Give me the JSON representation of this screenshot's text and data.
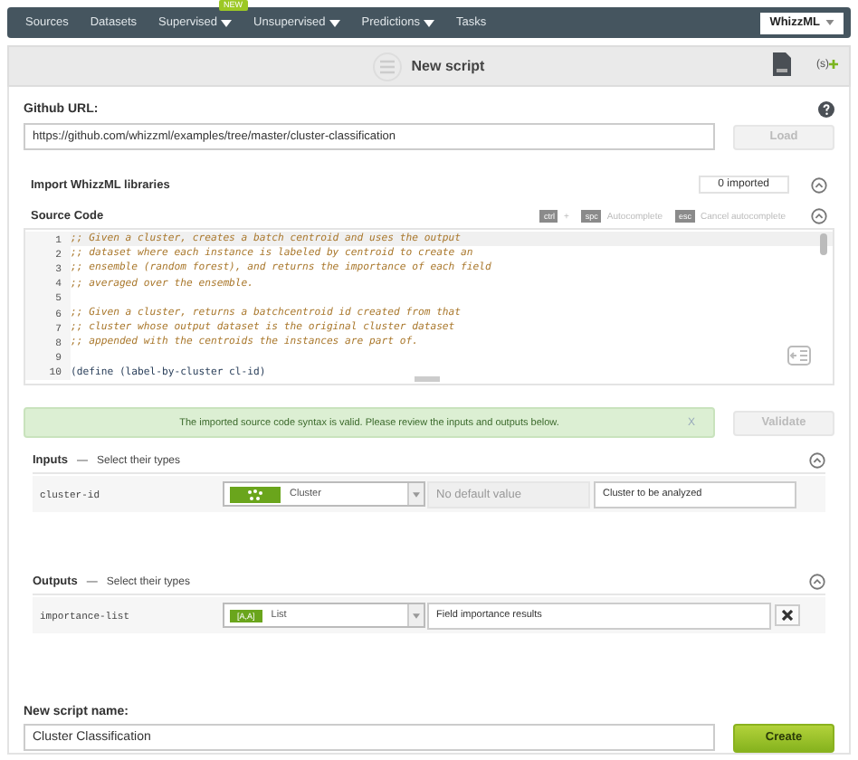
{
  "nav": {
    "items": [
      {
        "label": "Sources",
        "has_menu": false
      },
      {
        "label": "Datasets",
        "has_menu": false
      },
      {
        "label": "Supervised",
        "has_menu": true,
        "badge": "NEW"
      },
      {
        "label": "Unsupervised",
        "has_menu": true
      },
      {
        "label": "Predictions",
        "has_menu": true
      },
      {
        "label": "Tasks",
        "has_menu": false
      }
    ],
    "account": "WhizzML"
  },
  "header": {
    "title": "New script",
    "script_menu_label": "(s)"
  },
  "github": {
    "label": "Github URL:",
    "value": "https://github.com/whizzml/examples/tree/master/cluster-classification",
    "button": "Load",
    "button_disabled": true
  },
  "libraries": {
    "label": "Import WhizzML libraries",
    "count": "0 imported"
  },
  "source": {
    "label": "Source Code",
    "hints": [
      {
        "keys": [
          "ctrl",
          "spc"
        ],
        "joiner": "+",
        "action": "Autocomplete"
      },
      {
        "keys": [
          "esc"
        ],
        "action": "Cancel autocomplete"
      }
    ],
    "lines": [
      {
        "number": "1",
        "kind": "comment",
        "text": ";; Given a cluster, creates a batch centroid and uses the output",
        "selected": true
      },
      {
        "number": "2",
        "kind": "comment",
        "text": ";; dataset where each instance is labeled by centroid to create an",
        "selected": false
      },
      {
        "number": "3",
        "kind": "comment",
        "text": ";; ensemble (random forest), and returns the importance of each field",
        "selected": false
      },
      {
        "number": "4",
        "kind": "comment",
        "text": ";; averaged over the ensemble.",
        "selected": false
      },
      {
        "number": "5",
        "kind": "blank",
        "selected": false
      },
      {
        "number": "6",
        "kind": "comment",
        "text": ";; Given a cluster, returns a batchcentroid id created from that",
        "selected": false
      },
      {
        "number": "7",
        "kind": "comment",
        "text": ";; cluster whose output dataset is the original cluster dataset",
        "selected": false
      },
      {
        "number": "8",
        "kind": "comment",
        "text": ";; appended with the centroids the instances are part of.",
        "selected": false
      },
      {
        "number": "9",
        "kind": "blank",
        "selected": false
      },
      {
        "number": "10",
        "kind": "code",
        "text": "(define (label-by-cluster cl-id)",
        "selected": false
      }
    ]
  },
  "message": {
    "text": "The imported source code syntax is valid. Please review the inputs and outputs below.",
    "close": "X",
    "button": "Validate",
    "button_disabled": true
  },
  "inputs": {
    "title": "Inputs",
    "dash": "—",
    "subtitle": "Select their types",
    "rows": [
      {
        "name": "cluster-id",
        "kind": "cluster",
        "type": "Cluster",
        "default_placeholder": "No default value",
        "description": "Cluster to be analyzed"
      }
    ]
  },
  "outputs": {
    "title": "Outputs",
    "dash": "—",
    "subtitle": "Select their types",
    "rows": [
      {
        "name": "importance-list",
        "kind": "list",
        "chip": "[A,A]",
        "type": "List",
        "description": "Field importance results"
      }
    ]
  },
  "name": {
    "label": "New script name:",
    "value": "Cluster Classification",
    "button": "Create"
  }
}
